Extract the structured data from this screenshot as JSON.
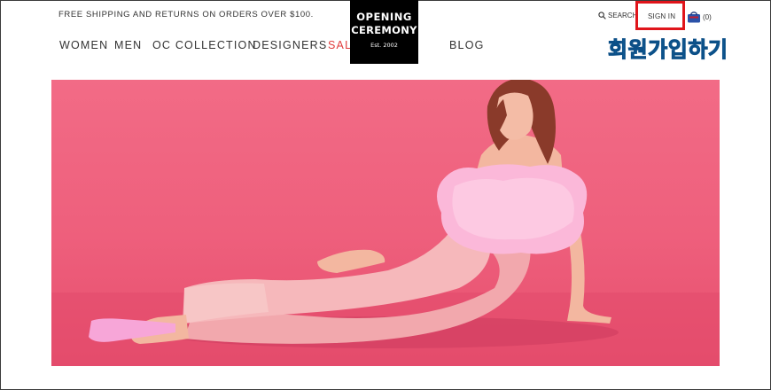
{
  "header": {
    "promo": "FREE SHIPPING AND RETURNS ON ORDERS OVER $100.",
    "logo": {
      "line1": "OPENING",
      "line2": "CEREMONY",
      "line3": "Est. 2002"
    },
    "nav": [
      {
        "label": "WOMEN"
      },
      {
        "label": "MEN"
      },
      {
        "label": "OC COLLECTION"
      },
      {
        "label": "DESIGNERS"
      },
      {
        "label": "SALE"
      },
      {
        "label": "BLOG"
      }
    ],
    "utility": {
      "search_label": "SEARCH",
      "signin_label": "SIGN IN",
      "cart_count": "(0)"
    },
    "korean_overlay": "회원가입하기"
  },
  "colors": {
    "sale": "#e03c3c",
    "highlight_box": "#e0151b",
    "korean_text": "#1f8fd6",
    "hero_background": "#ee5f7c",
    "cart_icon": "#2b52a8"
  },
  "hero": {
    "icon_names": [
      "model-photo"
    ]
  }
}
